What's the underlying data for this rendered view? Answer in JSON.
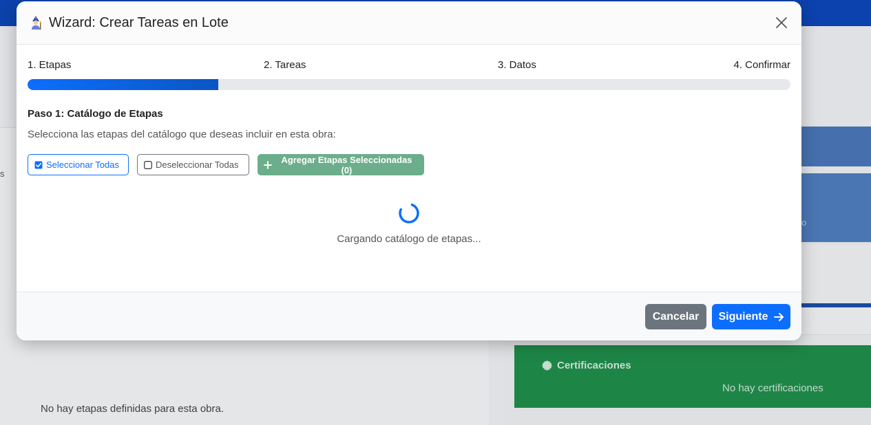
{
  "background": {
    "left_edge_text": "s",
    "no_stages_text": "No hay etapas definidas para esta obra.",
    "right_panel_fragment": "o",
    "certifications": {
      "title": "Certificaciones",
      "icon": "badge-icon",
      "empty_text": "No hay certificaciones"
    }
  },
  "modal": {
    "title": "Wizard: Crear Tareas en Lote",
    "title_icon": "wizard-icon",
    "close_icon": "close-icon",
    "steps": [
      {
        "label": "1. Etapas"
      },
      {
        "label": "2. Tareas"
      },
      {
        "label": "3. Datos"
      },
      {
        "label": "4. Confirmar"
      }
    ],
    "progress": 0.25,
    "step_heading": "Paso 1: Catálogo de Etapas",
    "step_description": "Selecciona las etapas del catálogo que deseas incluir en esta obra:",
    "buttons": {
      "select_all": "Seleccionar Todas",
      "deselect_all": "Deseleccionar Todas",
      "add_selected": "Agregar Etapas Seleccionadas (0)"
    },
    "loading_text": "Cargando catálogo de etapas...",
    "footer": {
      "cancel": "Cancelar",
      "next": "Siguiente"
    }
  },
  "colors": {
    "primary": "#0d6efd",
    "secondary": "#6c757d",
    "success_disabled": "#6cae8b",
    "certifications_bg": "#1f8f4c",
    "topbar": "#0d47b8"
  }
}
